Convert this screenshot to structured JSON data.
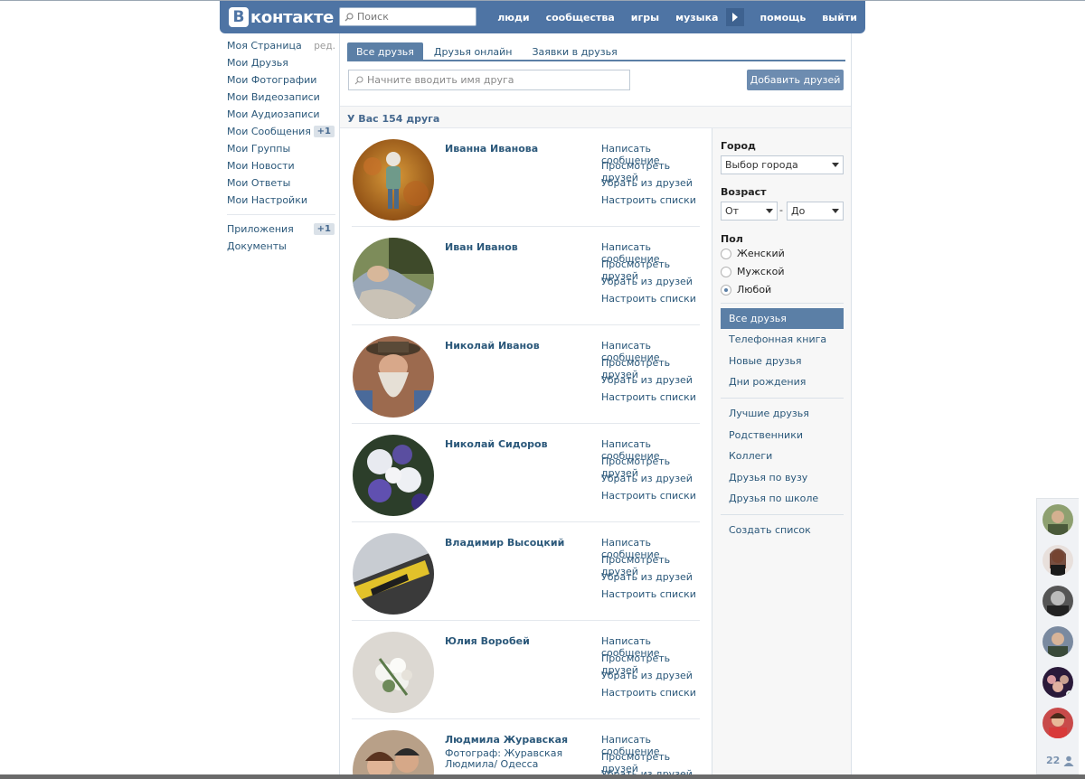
{
  "header": {
    "logo_letter": "В",
    "logo_text": "контакте",
    "search_placeholder": "Поиск",
    "nav": [
      "люди",
      "сообщества",
      "игры",
      "музыка",
      "помощь",
      "выйти"
    ]
  },
  "left_menu": {
    "edit_label": "ред.",
    "items": [
      {
        "label": "Моя Страница"
      },
      {
        "label": "Мои Друзья"
      },
      {
        "label": "Мои Фотографии"
      },
      {
        "label": "Мои Видеозаписи"
      },
      {
        "label": "Мои Аудиозаписи"
      },
      {
        "label": "Мои Сообщения",
        "badge": "+1"
      },
      {
        "label": "Мои Группы"
      },
      {
        "label": "Мои Новости"
      },
      {
        "label": "Мои Ответы"
      },
      {
        "label": "Мои Настройки"
      }
    ],
    "extra": [
      {
        "label": "Приложения",
        "badge": "+1"
      },
      {
        "label": "Документы"
      }
    ]
  },
  "tabs": [
    "Все друзья",
    "Друзья онлайн",
    "Заявки в друзья"
  ],
  "friend_search_placeholder": "Начните вводить имя друга",
  "add_friends_label": "Добавить друзей",
  "summary": "У Вас 154 друга",
  "actions": [
    "Написать сообщение",
    "Просмотреть друзей",
    "Убрать из друзей",
    "Настроить списки"
  ],
  "friends": [
    {
      "name": "Иванна Иванова",
      "sub": ""
    },
    {
      "name": "Иван Иванов",
      "sub": ""
    },
    {
      "name": "Николай Иванов",
      "sub": ""
    },
    {
      "name": "Николай Сидоров",
      "sub": ""
    },
    {
      "name": "Владимир Высоцкий",
      "sub": ""
    },
    {
      "name": "Юлия Воробей",
      "sub": ""
    },
    {
      "name": "Людмила Журавская",
      "sub": "Фотограф: Журавская Людмила/ Одесса"
    }
  ],
  "filters": {
    "city_title": "Город",
    "city_value": "Выбор города",
    "age_title": "Возраст",
    "age_from": "От",
    "age_to": "До",
    "gender_title": "Пол",
    "genders": [
      "Женский",
      "Мужской",
      "Любой"
    ],
    "selected_gender": "Любой",
    "lists_a": [
      "Все друзья",
      "Телефонная книга",
      "Новые друзья",
      "Дни рождения"
    ],
    "lists_b": [
      "Лучшие друзья",
      "Родственники",
      "Коллеги",
      "Друзья по вузу",
      "Друзья по школе"
    ],
    "create_list": "Создать список"
  },
  "chat": {
    "count": "22"
  },
  "colors": {
    "brand": "#4e74a4",
    "link": "#2b587a",
    "tab_active": "#5b7fa6"
  }
}
